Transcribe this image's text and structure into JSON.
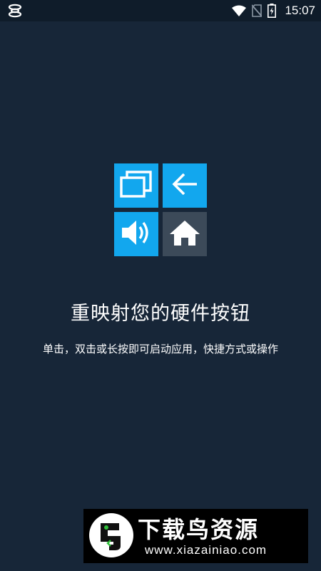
{
  "status_bar": {
    "time": "15:07",
    "icons": [
      "notification-icon",
      "wifi-icon",
      "no-sim-icon",
      "battery-charging-icon"
    ]
  },
  "logo": {
    "tiles": [
      {
        "icon": "recent-apps-icon",
        "color": "#12a7ee"
      },
      {
        "icon": "back-arrow-icon",
        "color": "#12a7ee"
      },
      {
        "icon": "volume-icon",
        "color": "#12a7ee"
      },
      {
        "icon": "home-icon",
        "color": "#3c4a59"
      }
    ]
  },
  "main": {
    "title": "重映射您的硬件按钮",
    "subtitle": "单击，双击或长按即可启动应用，快捷方式或操作"
  },
  "watermark": {
    "title": "下载鸟资源",
    "url": "www.xiazainiao.com"
  },
  "colors": {
    "background": "#172638",
    "status_bar": "#0f1c2a",
    "accent": "#12a7ee",
    "tile_gray": "#3c4a59"
  }
}
